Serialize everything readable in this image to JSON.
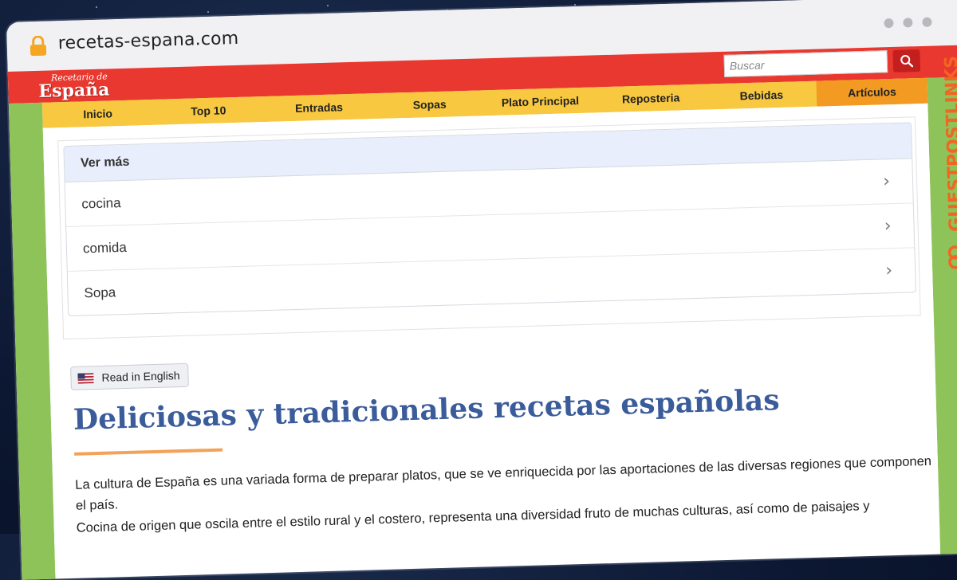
{
  "browser": {
    "url": "recetas-espana.com"
  },
  "site": {
    "logo_top": "Recetario de",
    "logo_main": "España",
    "search_placeholder": "Buscar"
  },
  "nav": [
    {
      "label": "Inicio"
    },
    {
      "label": "Top 10"
    },
    {
      "label": "Entradas"
    },
    {
      "label": "Sopas"
    },
    {
      "label": "Plato Principal"
    },
    {
      "label": "Reposteria"
    },
    {
      "label": "Bebidas"
    },
    {
      "label": "Artículos",
      "active": true
    }
  ],
  "see_more": {
    "header": "Ver más",
    "items": [
      {
        "label": "cocina"
      },
      {
        "label": "comida"
      },
      {
        "label": "Sopa"
      }
    ]
  },
  "language_button": "Read in English",
  "article": {
    "title": "Deliciosas y tradicionales recetas españolas",
    "paragraphs": [
      "La cultura de España es una variada forma de preparar platos, que se ve enriquecida por las aportaciones de las diversas regiones que componen el país.",
      "Cocina de origen que oscila entre el estilo rural y el costero, representa una diversidad fruto de muchas culturas, así como de paisajes y"
    ]
  },
  "watermark": "GUESTPOSTLINKS",
  "colors": {
    "header_red": "#e9382f",
    "nav_yellow": "#f8c840",
    "nav_active": "#f29a22",
    "side_green": "#8ec35a",
    "title_blue": "#3b5c9b",
    "underline_orange": "#f3a259",
    "watermark_orange": "#f26522"
  }
}
